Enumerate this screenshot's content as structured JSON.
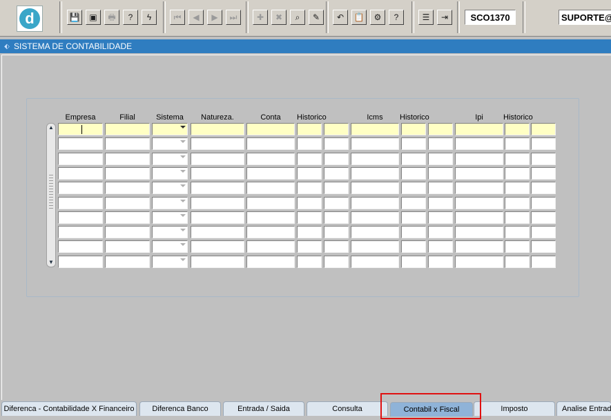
{
  "toolbar": {
    "groups": [
      [
        {
          "name": "save-icon",
          "glyph": "💾",
          "disabled": true
        },
        {
          "name": "form-window-icon",
          "glyph": "▣"
        },
        {
          "name": "print-icon",
          "glyph": "🖶",
          "disabled": true
        },
        {
          "name": "query-help-icon",
          "glyph": "?"
        },
        {
          "name": "lightning-icon",
          "glyph": "ϟ"
        }
      ],
      [
        {
          "name": "first-record-icon",
          "glyph": "⏮",
          "disabled": true
        },
        {
          "name": "previous-record-icon",
          "glyph": "◀",
          "disabled": true
        },
        {
          "name": "next-record-icon",
          "glyph": "▶",
          "disabled": true
        },
        {
          "name": "last-record-icon",
          "glyph": "⏭",
          "disabled": true
        }
      ],
      [
        {
          "name": "insert-record-icon",
          "glyph": "✚",
          "disabled": true
        },
        {
          "name": "delete-record-icon",
          "glyph": "✖",
          "disabled": true
        },
        {
          "name": "search-record-icon",
          "glyph": "⌕"
        },
        {
          "name": "edit-pencil-icon",
          "glyph": "✎"
        }
      ],
      [
        {
          "name": "undo-icon",
          "glyph": "↶"
        },
        {
          "name": "clipboard-icon",
          "glyph": "📋",
          "disabled": true
        },
        {
          "name": "settings-icon",
          "glyph": "⚙"
        },
        {
          "name": "help-icon",
          "glyph": "?"
        }
      ],
      [
        {
          "name": "menu-icon",
          "glyph": "☰"
        },
        {
          "name": "exit-door-icon",
          "glyph": "⇥"
        }
      ]
    ],
    "form_code": "SCO1370",
    "user": "SUPORTE@"
  },
  "window": {
    "title": "SISTEMA DE CONTABILIDADE"
  },
  "grid": {
    "headers": [
      "Empresa",
      "Filial",
      "Sistema",
      "Natureza.",
      "Conta",
      "Historico",
      "Icms",
      "Historico",
      "Ipi",
      "Historico"
    ],
    "row_count": 10
  },
  "tabs": [
    {
      "label": "Diferenca - Contabilidade X Financeiro",
      "active": false
    },
    {
      "label": "Diferenca Banco",
      "active": false
    },
    {
      "label": "Entrada / Saida",
      "active": false
    },
    {
      "label": "Consulta",
      "active": false
    },
    {
      "label": "Contabil x Fiscal",
      "active": true
    },
    {
      "label": "Imposto",
      "active": false
    },
    {
      "label": "Analise Entrada",
      "active": false
    }
  ],
  "colors": {
    "title_bar": "#2f7dc0",
    "active_tab": "#8fb3d8",
    "current_row": "#ffffc4",
    "highlight": "#e01010"
  }
}
